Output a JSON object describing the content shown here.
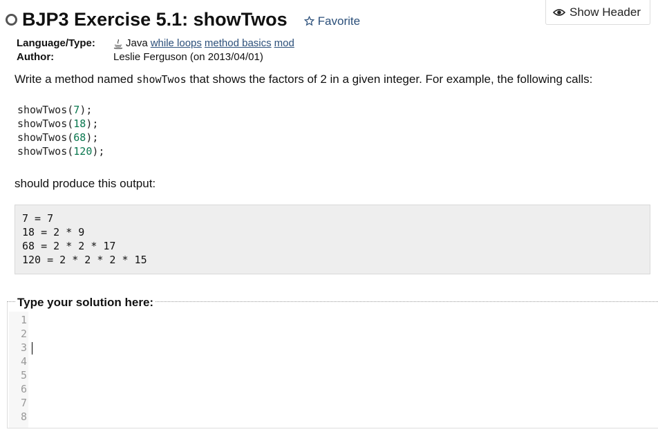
{
  "header": {
    "show_header_label": "Show Header",
    "title": "BJP3 Exercise 5.1: showTwos",
    "favorite_label": "Favorite"
  },
  "meta": {
    "language_label": "Language/Type:",
    "language_value": "Java",
    "tags": [
      "while loops",
      "method basics",
      "mod"
    ],
    "author_label": "Author:",
    "author_value": "Leslie Ferguson (on 2013/04/01)"
  },
  "description": {
    "part1": "Write a method named ",
    "method_name": "showTwos",
    "part2": " that shows the factors of 2 in a given integer. For example, the following calls:",
    "calls": [
      {
        "prefix": "showTwos(",
        "arg": "7",
        "suffix": ");"
      },
      {
        "prefix": "showTwos(",
        "arg": "18",
        "suffix": ");"
      },
      {
        "prefix": "showTwos(",
        "arg": "68",
        "suffix": ");"
      },
      {
        "prefix": "showTwos(",
        "arg": "120",
        "suffix": ");"
      }
    ],
    "output_intro": "should produce this output:",
    "output_lines": [
      "7 = 7",
      "18 = 2 * 9",
      "68 = 2 * 2 * 17",
      "120 = 2 * 2 * 2 * 15"
    ]
  },
  "solution": {
    "legend": "Type your solution here:",
    "line_numbers": [
      "1",
      "2",
      "3",
      "4",
      "5",
      "6",
      "7",
      "8"
    ]
  }
}
